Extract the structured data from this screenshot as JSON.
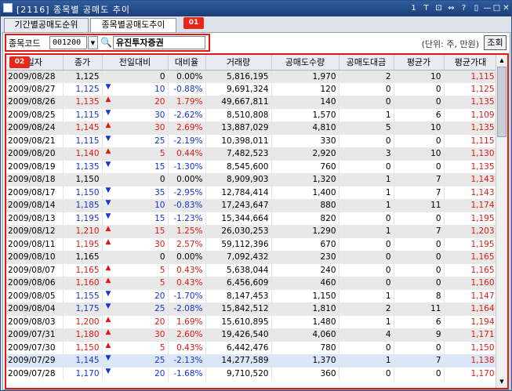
{
  "window": {
    "title": "[2116] 종목별 공매도 추이",
    "buttons": [
      "1",
      "T",
      "⊡",
      "⇔",
      "?",
      "▯",
      "—",
      "□",
      "✕"
    ]
  },
  "tabs": [
    {
      "label": "기간별공매도순위"
    },
    {
      "label": "종목별공매도추이"
    }
  ],
  "callouts": {
    "c1": "01",
    "c2": "02"
  },
  "search": {
    "label": "종목코드",
    "code": "001200",
    "name": "유진투자증권"
  },
  "unit": "(단위: 주, 만원)",
  "query": "조회",
  "columns": [
    "일자",
    "종가",
    "전일대비",
    "대비율",
    "거래량",
    "공매도수량",
    "공매도대금",
    "평균가",
    "평균가대"
  ],
  "rows": [
    [
      "2009/08/28",
      "1,125",
      "",
      "0",
      "0.00%",
      "5,816,195",
      "1,970",
      "2",
      "10",
      "1,115"
    ],
    [
      "2009/08/27",
      "1,125",
      "down",
      "10",
      "-0.88%",
      "9,691,324",
      "120",
      "0",
      "0",
      "1,125"
    ],
    [
      "2009/08/26",
      "1,135",
      "up",
      "20",
      "1.79%",
      "49,667,811",
      "140",
      "0",
      "0",
      "1,135"
    ],
    [
      "2009/08/25",
      "1,115",
      "down",
      "30",
      "-2.62%",
      "8,510,808",
      "1,570",
      "1",
      "6",
      "1,109"
    ],
    [
      "2009/08/24",
      "1,145",
      "up",
      "30",
      "2.69%",
      "13,887,029",
      "4,810",
      "5",
      "10",
      "1,135"
    ],
    [
      "2009/08/21",
      "1,115",
      "down",
      "25",
      "-2.19%",
      "10,398,011",
      "330",
      "0",
      "0",
      "1,115"
    ],
    [
      "2009/08/20",
      "1,140",
      "up",
      "5",
      "0.44%",
      "7,482,523",
      "2,920",
      "3",
      "10",
      "1,130"
    ],
    [
      "2009/08/19",
      "1,135",
      "down",
      "15",
      "-1.30%",
      "8,545,600",
      "760",
      "0",
      "0",
      "1,135"
    ],
    [
      "2009/08/18",
      "1,150",
      "",
      "0",
      "0.00%",
      "8,909,903",
      "1,320",
      "1",
      "7",
      "1,143"
    ],
    [
      "2009/08/17",
      "1,150",
      "down",
      "35",
      "-2.95%",
      "12,784,414",
      "1,400",
      "1",
      "7",
      "1,143"
    ],
    [
      "2009/08/14",
      "1,185",
      "down",
      "10",
      "-0.83%",
      "17,243,647",
      "880",
      "1",
      "11",
      "1,174"
    ],
    [
      "2009/08/13",
      "1,195",
      "down",
      "15",
      "-1.23%",
      "15,344,664",
      "820",
      "0",
      "0",
      "1,195"
    ],
    [
      "2009/08/12",
      "1,210",
      "up",
      "15",
      "1.25%",
      "26,030,253",
      "1,290",
      "1",
      "7",
      "1,203"
    ],
    [
      "2009/08/11",
      "1,195",
      "up",
      "30",
      "2.57%",
      "59,112,396",
      "670",
      "0",
      "0",
      "1,195"
    ],
    [
      "2009/08/10",
      "1,165",
      "",
      "0",
      "0.00%",
      "7,092,432",
      "230",
      "0",
      "0",
      "1,165"
    ],
    [
      "2009/08/07",
      "1,165",
      "up",
      "5",
      "0.43%",
      "5,638,044",
      "240",
      "0",
      "0",
      "1,165"
    ],
    [
      "2009/08/06",
      "1,160",
      "up",
      "5",
      "0.43%",
      "6,456,609",
      "460",
      "0",
      "0",
      "1,160"
    ],
    [
      "2009/08/05",
      "1,155",
      "down",
      "20",
      "-1.70%",
      "8,147,453",
      "1,150",
      "1",
      "8",
      "1,147"
    ],
    [
      "2009/08/04",
      "1,175",
      "down",
      "25",
      "-2.08%",
      "15,842,512",
      "1,810",
      "2",
      "11",
      "1,164"
    ],
    [
      "2009/08/03",
      "1,200",
      "up",
      "20",
      "1.69%",
      "15,610,895",
      "1,480",
      "1",
      "6",
      "1,194"
    ],
    [
      "2009/07/31",
      "1,180",
      "up",
      "30",
      "2.60%",
      "19,426,540",
      "4,060",
      "4",
      "9",
      "1,171"
    ],
    [
      "2009/07/30",
      "1,150",
      "up",
      "5",
      "0.43%",
      "6,442,476",
      "780",
      "0",
      "0",
      "1,150"
    ],
    [
      "2009/07/29",
      "1,145",
      "down",
      "25",
      "-2.13%",
      "14,277,589",
      "1,370",
      "1",
      "7",
      "1,138"
    ],
    [
      "2009/07/28",
      "1,170",
      "down",
      "20",
      "-1.68%",
      "9,710,520",
      "360",
      "0",
      "0",
      "1,170"
    ]
  ],
  "selected_row": 22,
  "colors": {
    "up": "#e0190f",
    "down": "#1434d6",
    "highlight": "#e01a10"
  }
}
